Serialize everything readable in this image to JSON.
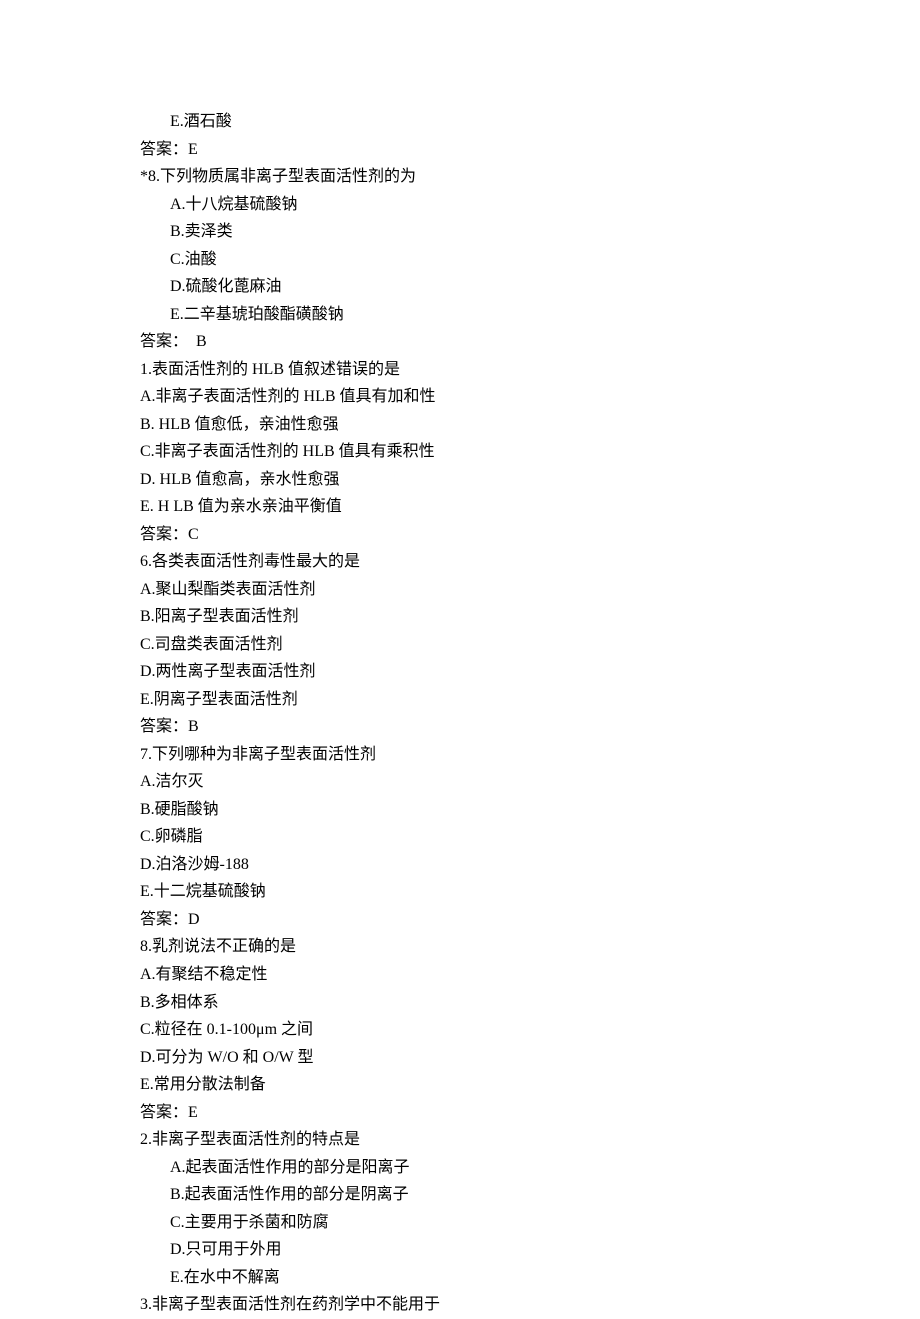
{
  "lines": [
    {
      "text": "E.酒石酸",
      "indent": true
    },
    {
      "text": "答案：E",
      "indent": false
    },
    {
      "text": "*8.下列物质属非离子型表面活性剂的为",
      "indent": false
    },
    {
      "text": "A.十八烷基硫酸钠",
      "indent": true
    },
    {
      "text": "B.卖泽类",
      "indent": true
    },
    {
      "text": "C.油酸",
      "indent": true
    },
    {
      "text": "D.硫酸化蓖麻油",
      "indent": true
    },
    {
      "text": "E.二辛基琥珀酸酯磺酸钠",
      "indent": true
    },
    {
      "text": "答案：  B",
      "indent": false
    },
    {
      "text": "1.表面活性剂的 HLB 值叙述错误的是",
      "indent": false
    },
    {
      "text": "A.非离子表面活性剂的 HLB 值具有加和性",
      "indent": false
    },
    {
      "text": "B. HLB 值愈低，亲油性愈强",
      "indent": false
    },
    {
      "text": "C.非离子表面活性剂的 HLB 值具有乘积性",
      "indent": false
    },
    {
      "text": "D. HLB 值愈高，亲水性愈强",
      "indent": false
    },
    {
      "text": "E. H LB 值为亲水亲油平衡值",
      "indent": false
    },
    {
      "text": "答案：C",
      "indent": false
    },
    {
      "text": "6.各类表面活性剂毒性最大的是",
      "indent": false
    },
    {
      "text": "A.聚山梨酯类表面活性剂",
      "indent": false
    },
    {
      "text": "B.阳离子型表面活性剂",
      "indent": false
    },
    {
      "text": "C.司盘类表面活性剂",
      "indent": false
    },
    {
      "text": "D.两性离子型表面活性剂",
      "indent": false
    },
    {
      "text": "E.阴离子型表面活性剂",
      "indent": false
    },
    {
      "text": "答案：B",
      "indent": false
    },
    {
      "text": "7.下列哪种为非离子型表面活性剂",
      "indent": false
    },
    {
      "text": "A.洁尔灭",
      "indent": false
    },
    {
      "text": "B.硬脂酸钠",
      "indent": false
    },
    {
      "text": "C.卵磷脂",
      "indent": false
    },
    {
      "text": "D.泊洛沙姆-188",
      "indent": false
    },
    {
      "text": "E.十二烷基硫酸钠",
      "indent": false
    },
    {
      "text": "答案：D",
      "indent": false
    },
    {
      "text": "8.乳剂说法不正确的是",
      "indent": false
    },
    {
      "text": "A.有聚结不稳定性",
      "indent": false
    },
    {
      "text": "B.多相体系",
      "indent": false
    },
    {
      "text": "C.粒径在 0.1-100μm 之间",
      "indent": false
    },
    {
      "text": "D.可分为 W/O 和 O/W 型",
      "indent": false
    },
    {
      "text": "E.常用分散法制备",
      "indent": false
    },
    {
      "text": "答案：E",
      "indent": false
    },
    {
      "text": "2.非离子型表面活性剂的特点是",
      "indent": false
    },
    {
      "text": "A.起表面活性作用的部分是阳离子",
      "indent": true
    },
    {
      "text": "B.起表面活性作用的部分是阴离子",
      "indent": true
    },
    {
      "text": "C.主要用于杀菌和防腐",
      "indent": true
    },
    {
      "text": "D.只可用于外用",
      "indent": true
    },
    {
      "text": "E.在水中不解离",
      "indent": true
    },
    {
      "text": "3.非离子型表面活性剂在药剂学中不能用于",
      "indent": false
    }
  ]
}
